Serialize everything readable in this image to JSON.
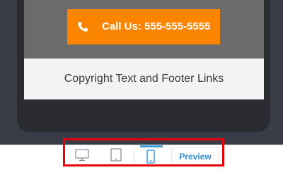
{
  "preview": {
    "call_button_label": "Call Us: 555-555-5555",
    "footer_text": "Copyright Text and Footer Links"
  },
  "toolbar": {
    "devices": [
      {
        "name": "desktop",
        "icon": "desktop-icon",
        "active": false
      },
      {
        "name": "tablet",
        "icon": "tablet-icon",
        "active": false
      },
      {
        "name": "mobile",
        "icon": "mobile-icon",
        "active": true
      }
    ],
    "preview_label": "Preview"
  },
  "colors": {
    "accent_orange": "#fb8500",
    "highlight_red": "#e8000a",
    "active_blue": "#3fa0dd",
    "preview_text_blue": "#2e8fd6"
  }
}
